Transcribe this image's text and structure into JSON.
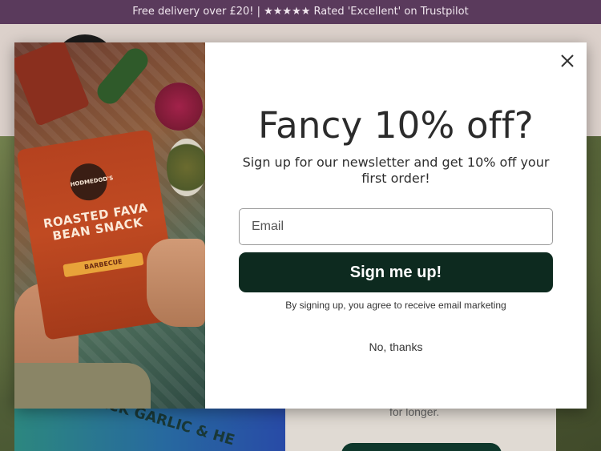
{
  "announcement": {
    "text": "Free delivery over £20! | ★★★★★ Rated 'Excellent' on Trustpilot"
  },
  "hero": {
    "copy": "for longer.",
    "pack_text": "BLACK GARLIC & HE"
  },
  "modal": {
    "image": {
      "bag_title": "ROASTED FAVA BEAN SNACK",
      "bag_flavour": "BARBECUE",
      "bag_brand": "HODMEDOD'S"
    },
    "close_icon": "close-icon",
    "title": "Fancy 10% off?",
    "subtitle": "Sign up for our newsletter and get 10% off your first order!",
    "email_placeholder": "Email",
    "email_value": "",
    "submit_label": "Sign me up!",
    "consent_text": "By signing up, you agree to receive email marketing",
    "decline_label": "No, thanks"
  },
  "colors": {
    "announcement_bg": "#5a3a5c",
    "submit_bg": "#0d2a1f",
    "modal_bg": "#ffffff"
  }
}
